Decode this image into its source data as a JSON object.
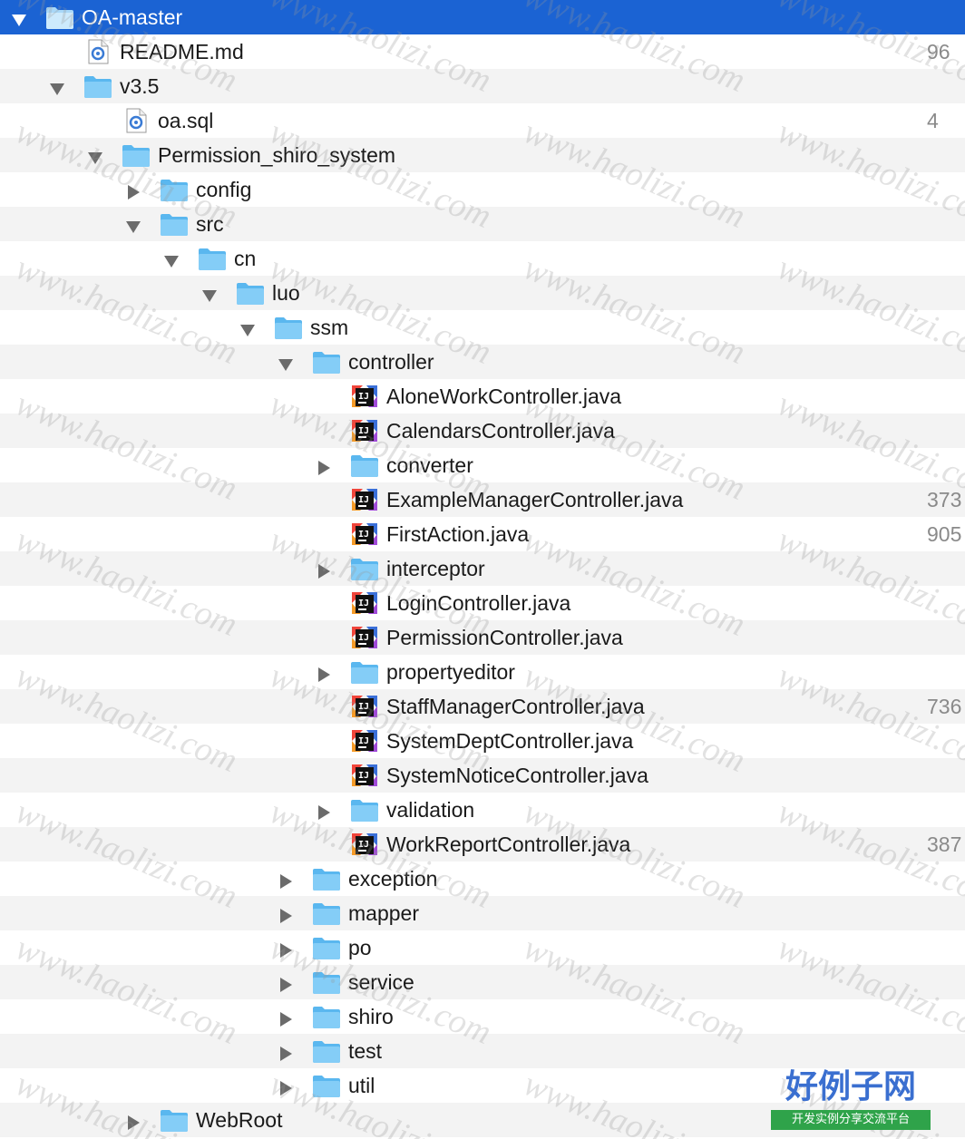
{
  "tree": [
    {
      "label": "OA-master",
      "type": "folder",
      "depth": 0,
      "arrow": "down",
      "selected": true
    },
    {
      "label": "README.md",
      "type": "md",
      "depth": 1,
      "arrow": "none",
      "size": "96"
    },
    {
      "label": "v3.5",
      "type": "folder",
      "depth": 1,
      "arrow": "down"
    },
    {
      "label": "oa.sql",
      "type": "sql",
      "depth": 2,
      "arrow": "none",
      "size": "4"
    },
    {
      "label": "Permission_shiro_system",
      "type": "folder",
      "depth": 2,
      "arrow": "down"
    },
    {
      "label": "config",
      "type": "folder",
      "depth": 3,
      "arrow": "right"
    },
    {
      "label": "src",
      "type": "folder",
      "depth": 3,
      "arrow": "down"
    },
    {
      "label": "cn",
      "type": "folder",
      "depth": 4,
      "arrow": "down"
    },
    {
      "label": "luo",
      "type": "folder",
      "depth": 5,
      "arrow": "down"
    },
    {
      "label": "ssm",
      "type": "folder",
      "depth": 6,
      "arrow": "down"
    },
    {
      "label": "controller",
      "type": "folder",
      "depth": 7,
      "arrow": "down"
    },
    {
      "label": "AloneWorkController.java",
      "type": "java",
      "depth": 8,
      "arrow": "none"
    },
    {
      "label": "CalendarsController.java",
      "type": "java",
      "depth": 8,
      "arrow": "none"
    },
    {
      "label": "converter",
      "type": "folder",
      "depth": 8,
      "arrow": "right"
    },
    {
      "label": "ExampleManagerController.java",
      "type": "java",
      "depth": 8,
      "arrow": "none",
      "size": "373"
    },
    {
      "label": "FirstAction.java",
      "type": "java",
      "depth": 8,
      "arrow": "none",
      "size": "905"
    },
    {
      "label": "interceptor",
      "type": "folder",
      "depth": 8,
      "arrow": "right"
    },
    {
      "label": "LoginController.java",
      "type": "java",
      "depth": 8,
      "arrow": "none"
    },
    {
      "label": "PermissionController.java",
      "type": "java",
      "depth": 8,
      "arrow": "none"
    },
    {
      "label": "propertyeditor",
      "type": "folder",
      "depth": 8,
      "arrow": "right"
    },
    {
      "label": "StaffManagerController.java",
      "type": "java",
      "depth": 8,
      "arrow": "none",
      "size": "736"
    },
    {
      "label": "SystemDeptController.java",
      "type": "java",
      "depth": 8,
      "arrow": "none"
    },
    {
      "label": "SystemNoticeController.java",
      "type": "java",
      "depth": 8,
      "arrow": "none"
    },
    {
      "label": "validation",
      "type": "folder",
      "depth": 8,
      "arrow": "right"
    },
    {
      "label": "WorkReportController.java",
      "type": "java",
      "depth": 8,
      "arrow": "none",
      "size": "387"
    },
    {
      "label": "exception",
      "type": "folder",
      "depth": 7,
      "arrow": "right"
    },
    {
      "label": "mapper",
      "type": "folder",
      "depth": 7,
      "arrow": "right"
    },
    {
      "label": "po",
      "type": "folder",
      "depth": 7,
      "arrow": "right"
    },
    {
      "label": "service",
      "type": "folder",
      "depth": 7,
      "arrow": "right"
    },
    {
      "label": "shiro",
      "type": "folder",
      "depth": 7,
      "arrow": "right"
    },
    {
      "label": "test",
      "type": "folder",
      "depth": 7,
      "arrow": "right"
    },
    {
      "label": "util",
      "type": "folder",
      "depth": 7,
      "arrow": "right"
    },
    {
      "label": "WebRoot",
      "type": "folder",
      "depth": 3,
      "arrow": "right"
    }
  ],
  "watermark": "www.haolizi.com",
  "logo": {
    "title": "好例子网",
    "subtitle": "开发实例分享交流平台"
  },
  "colors": {
    "selection": "#1b63d3",
    "folder": "#6cc4f5",
    "alt_row": "#f3f3f3",
    "logo_blue": "#3a6fd0",
    "logo_green": "#2fa34a"
  }
}
